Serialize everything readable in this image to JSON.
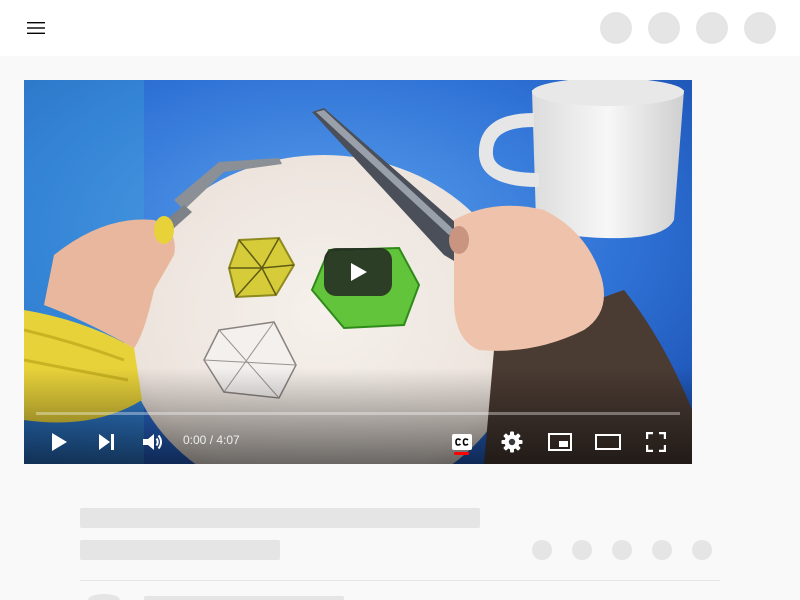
{
  "topbar": {
    "menu_icon": "hamburger-menu-icon",
    "placeholders": [
      "avatar-placeholder",
      "avatar-placeholder",
      "avatar-placeholder",
      "avatar-placeholder"
    ]
  },
  "player": {
    "time_display": "0:00 / 4:07",
    "progress_fraction": 0.0,
    "captions_enabled": true,
    "controls": {
      "play_icon": "play-icon",
      "next_icon": "skip-next-icon",
      "volume_icon": "volume-icon",
      "captions_icon": "closed-captions-icon",
      "settings_icon": "gear-icon",
      "miniplayer_icon": "miniplayer-icon",
      "theater_icon": "theater-mode-icon",
      "fullscreen_icon": "fullscreen-icon"
    },
    "colors": {
      "accent": "#ff0000",
      "background": "#2a6fd8"
    }
  },
  "loading_skeleton": {
    "title_line": "",
    "subtitle_line": "",
    "action_placeholders": 5
  }
}
